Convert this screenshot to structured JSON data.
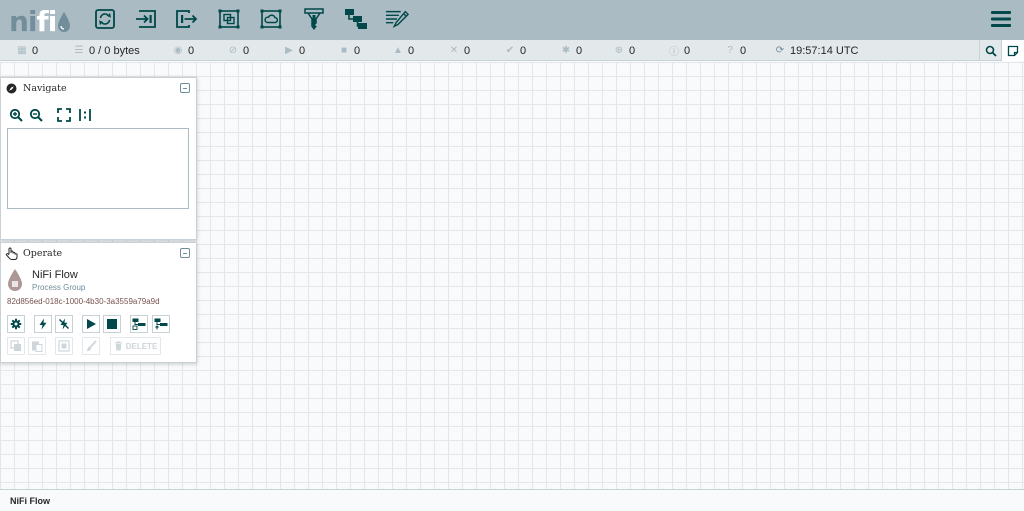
{
  "app": {
    "logo_ni": "ni",
    "logo_fi": "fi"
  },
  "toolbar": {
    "items": [
      {
        "name": "processor-icon"
      },
      {
        "name": "input-port-icon"
      },
      {
        "name": "output-port-icon"
      },
      {
        "name": "process-group-icon"
      },
      {
        "name": "remote-process-group-icon"
      },
      {
        "name": "funnel-icon"
      },
      {
        "name": "template-icon"
      },
      {
        "name": "label-icon"
      }
    ]
  },
  "status_bar": {
    "active_threads": "0",
    "queued": "0 / 0 bytes",
    "transmitting": "0",
    "not_transmitting": "0",
    "running": "0",
    "stopped": "0",
    "invalid": "0",
    "disabled": "0",
    "up_to_date": "0",
    "locally_modified": "0",
    "stale": "0",
    "locally_modified_stale": "0",
    "sync_failure": "0",
    "last_refreshed": "19:57:14 UTC"
  },
  "navigate": {
    "title": "Navigate"
  },
  "operate": {
    "title": "Operate",
    "component_name": "NiFi Flow",
    "component_type": "Process Group",
    "component_id": "82d856ed-018c-1000-4b30-3a3559a79a9d",
    "delete_label": "DELETE"
  },
  "breadcrumb": {
    "current": "NiFi Flow"
  },
  "colors": {
    "header": "#aabbc3",
    "accent": "#004849",
    "muted": "#728e9b",
    "status_bar": "#e3e8eb"
  }
}
